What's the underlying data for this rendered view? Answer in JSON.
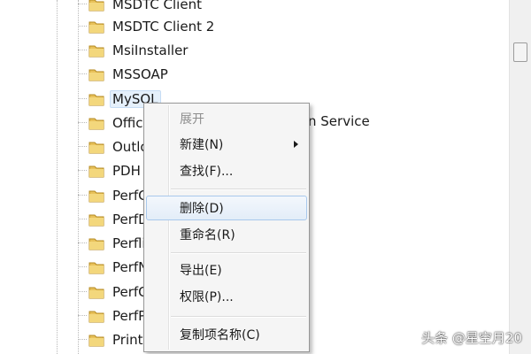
{
  "tree": {
    "items": [
      {
        "label": "MSDTC Client"
      },
      {
        "label": "MSDTC Client 2"
      },
      {
        "label": "MsiInstaller"
      },
      {
        "label": "MSSOAP"
      },
      {
        "label": "MySQL",
        "selected": true
      },
      {
        "label": "Office"
      },
      {
        "label": "Outlo"
      },
      {
        "label": "PDH"
      },
      {
        "label": "PerfC"
      },
      {
        "label": "PerfD"
      },
      {
        "label": "Perflib"
      },
      {
        "label": "PerfN"
      },
      {
        "label": "PerfO"
      },
      {
        "label": "PerfPr"
      },
      {
        "label": "PrintB"
      }
    ],
    "partial_text": "n Service",
    "folder_color": "#e8c15a"
  },
  "context_menu": {
    "items": {
      "expand": "展开",
      "new": "新建(N)",
      "find": "查找(F)...",
      "delete": "删除(D)",
      "rename": "重命名(R)",
      "export": "导出(E)",
      "permissions": "权限(P)...",
      "copy_key_name": "复制项名称(C)"
    },
    "hover_color": "#a8c8ec"
  },
  "watermark": "头条 @星空月20"
}
